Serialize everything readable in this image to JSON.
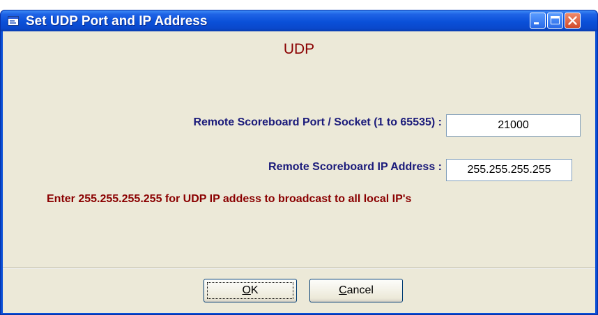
{
  "window": {
    "title": "Set UDP Port and IP Address"
  },
  "heading": "UDP",
  "fields": {
    "port_label": "Remote Scoreboard Port / Socket (1 to 65535) :",
    "port_value": "21000",
    "ip_label": "Remote Scoreboard IP Address :",
    "ip_value": "255.255.255.255"
  },
  "hint": "Enter 255.255.255.255 for UDP IP addess to broadcast to all local IP's",
  "buttons": {
    "ok_mnemonic": "O",
    "ok_rest": "K",
    "cancel_mnemonic": "C",
    "cancel_rest": "ancel"
  },
  "icons": {
    "app": "app-window-icon",
    "minimize": "minimize-icon",
    "maximize": "maximize-icon",
    "close": "close-icon"
  },
  "colors": {
    "titlebar": "#0a50d8",
    "heading": "#8a0000",
    "label": "#1a1a7a",
    "hint": "#8a0000",
    "client_bg": "#ece9d8",
    "close_button": "#d14a2a"
  }
}
